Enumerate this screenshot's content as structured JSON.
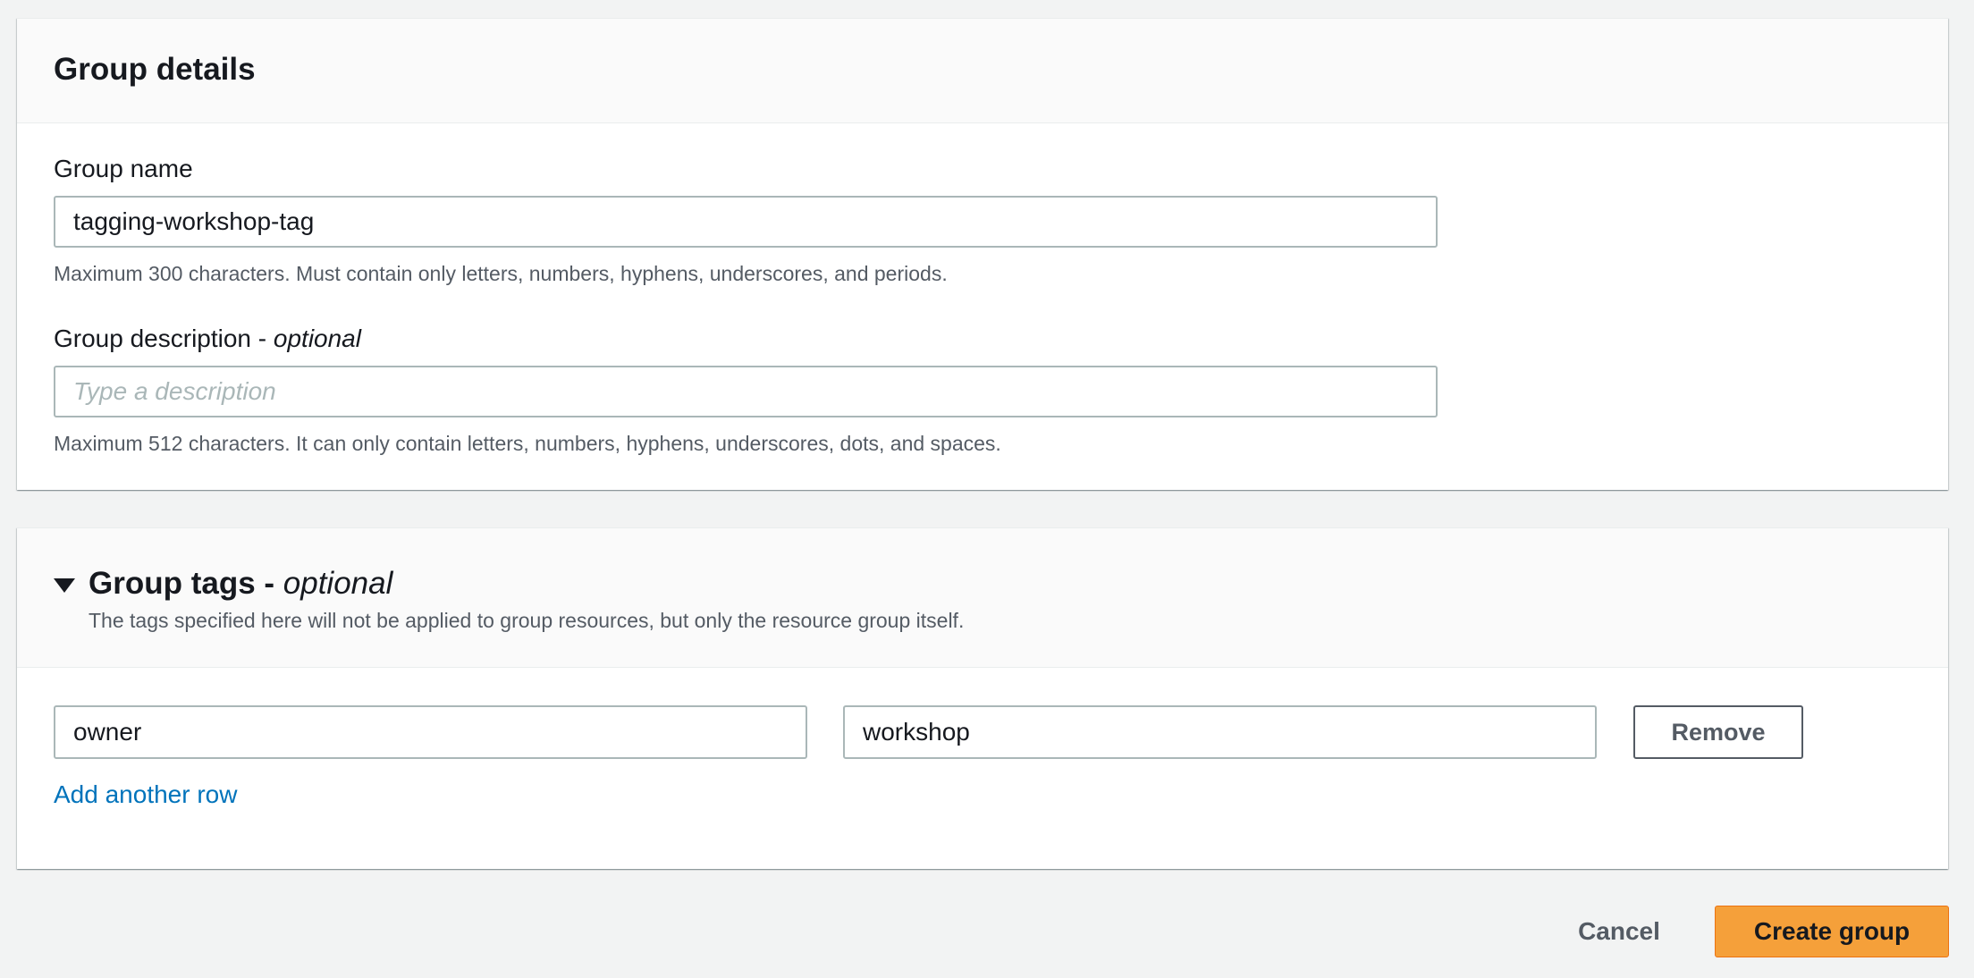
{
  "group_details": {
    "title": "Group details",
    "name_label": "Group name",
    "name_value": "tagging-workshop-tag",
    "name_constraint": "Maximum 300 characters. Must contain only letters, numbers, hyphens, underscores, and periods.",
    "description_label": "Group description - ",
    "description_optional": "optional",
    "description_value": "",
    "description_placeholder": "Type a description",
    "description_constraint": "Maximum 512 characters. It can only contain letters, numbers, hyphens, underscores, dots, and spaces."
  },
  "group_tags": {
    "title": "Group tags - ",
    "title_optional": "optional",
    "description": "The tags specified here will not be applied to group resources, but only the resource group itself.",
    "rows": [
      {
        "key": "owner",
        "value": "workshop",
        "remove_label": "Remove"
      }
    ],
    "add_row_label": "Add another row"
  },
  "actions": {
    "cancel_label": "Cancel",
    "create_label": "Create group"
  },
  "colors": {
    "primary_button": "#f5a03a",
    "link": "#0073bb",
    "page_background": "#f2f3f3"
  }
}
